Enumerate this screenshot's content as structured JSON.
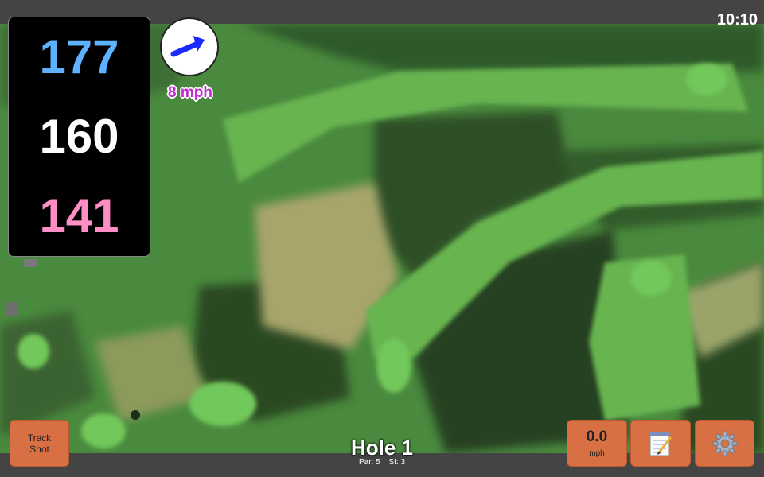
{
  "status": {
    "time": "10:10"
  },
  "yardages": {
    "back": "177",
    "middle": "160",
    "front": "141"
  },
  "wind": {
    "speed": "8 mph",
    "icon": "wind-arrow-icon"
  },
  "hole": {
    "title": "Hole 1",
    "par": "Par: 5",
    "si": "SI: 3"
  },
  "buttons": {
    "track_shot_line1": "Track",
    "track_shot_line2": "Shot",
    "speed_value": "0.0",
    "speed_unit": "mph",
    "notes_icon": "notepad-icon",
    "settings_icon": "gear-icon"
  },
  "colors": {
    "back": "#5eb1ff",
    "middle": "#ffffff",
    "front": "#ff8ec7",
    "button": "#d87044",
    "wind_text": "#c229d2"
  }
}
